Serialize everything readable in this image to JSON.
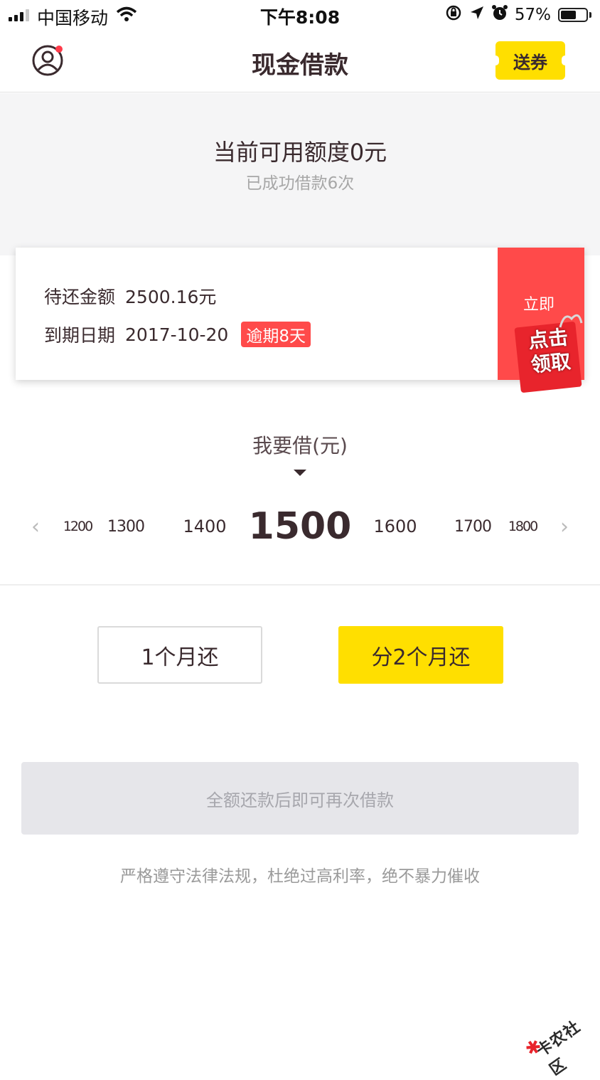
{
  "status_bar": {
    "carrier": "中国移动",
    "time": "下午8:08",
    "battery": "57%"
  },
  "nav": {
    "title": "现金借款",
    "coupon_label": "送券"
  },
  "quota": {
    "title": "当前可用额度0元",
    "subtitle": "已成功借款6次"
  },
  "loan_card": {
    "amount_label": "待还金额",
    "amount_value": "2500.16元",
    "due_label": "到期日期",
    "due_value": "2017-10-20",
    "overdue_badge": "逾期8天",
    "promo_top": "立即",
    "promo_gift_line1": "点击",
    "promo_gift_line2": "领取"
  },
  "amount_picker": {
    "label": "我要借(元)",
    "prev_arrow": "‹",
    "next_arrow": "›",
    "values": [
      "1200",
      "1300",
      "1400",
      "1500",
      "1600",
      "1700",
      "1800"
    ],
    "selected": "1500"
  },
  "terms": {
    "option1": "1个月还",
    "option2": "分2个月还"
  },
  "reloan_button": "全额还款后即可再次借款",
  "footnote": "严格遵守法律法规，杜绝过高利率，绝不暴力催收",
  "watermark": "卡农社区",
  "colors": {
    "accent_yellow": "#ffdf00",
    "alert_red": "#ff4a4a",
    "text_dark": "#3a2a2e"
  }
}
